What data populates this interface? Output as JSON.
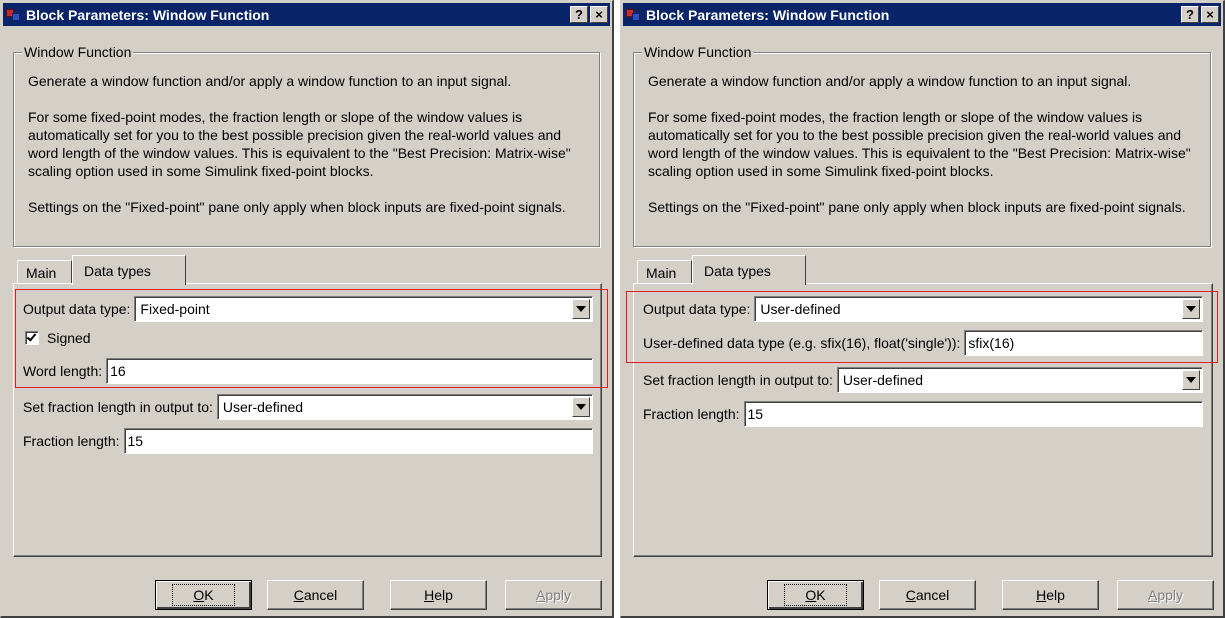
{
  "dialogs": {
    "left": {
      "title": "Block Parameters: Window Function",
      "help_btn": "?",
      "close_btn": "×",
      "group_title": "Window Function",
      "desc_1": "Generate a window function and/or apply a window function to an input signal.",
      "desc_2": "For some fixed-point modes, the fraction length or slope of the window values is automatically set for you to the best possible precision given the real-world values and word length of the window values. This is equivalent to the \"Best Precision: Matrix-wise\" scaling option used in some Simulink fixed-point blocks.",
      "desc_3": "Settings on the \"Fixed-point\" pane only apply when block inputs are fixed-point signals.",
      "tabs": [
        "Main",
        "Data types"
      ],
      "output_label": "Output data type:",
      "output_value": "Fixed-point",
      "signed_label": "Signed",
      "signed_checked": true,
      "word_length_label": "Word length:",
      "word_length_value": "16",
      "fraction_mode_label": "Set fraction length in output to:",
      "fraction_mode_value": "User-defined",
      "fraction_length_label": "Fraction length:",
      "fraction_length_value": "15",
      "buttons": {
        "ok_prefix": "",
        "ok_mnemonic": "O",
        "ok_rest": "K",
        "cancel_mnemonic": "C",
        "cancel_rest": "ancel",
        "help_mnemonic": "H",
        "help_rest": "elp",
        "apply_mnemonic": "A",
        "apply_rest": "pply"
      }
    },
    "right": {
      "title": "Block Parameters: Window Function",
      "help_btn": "?",
      "close_btn": "×",
      "group_title": "Window Function",
      "desc_1": "Generate a window function and/or apply a window function to an input signal.",
      "desc_2": "For some fixed-point modes, the fraction length or slope of the window values is automatically set for you to the best possible precision given the real-world values and word length of the window values. This is equivalent to the \"Best Precision: Matrix-wise\" scaling option used in some Simulink fixed-point blocks.",
      "desc_3": "Settings on the \"Fixed-point\" pane only apply when block inputs are fixed-point signals.",
      "tabs": [
        "Main",
        "Data types"
      ],
      "output_label": "Output data type:",
      "output_value": "User-defined",
      "udt_label": "User-defined data type  (e.g. sfix(16), float('single')):",
      "udt_value": "sfix(16)",
      "fraction_mode_label": "Set fraction length in output to:",
      "fraction_mode_value": "User-defined",
      "fraction_length_label": "Fraction length:",
      "fraction_length_value": "15",
      "buttons": {
        "ok_mnemonic": "O",
        "ok_rest": "K",
        "cancel_mnemonic": "C",
        "cancel_rest": "ancel",
        "help_mnemonic": "H",
        "help_rest": "elp",
        "apply_mnemonic": "A",
        "apply_rest": "pply"
      }
    }
  },
  "colors": {
    "titlebar": "#0a246a",
    "dialog_face": "#d4d0c8",
    "highlight": "#e02020"
  }
}
